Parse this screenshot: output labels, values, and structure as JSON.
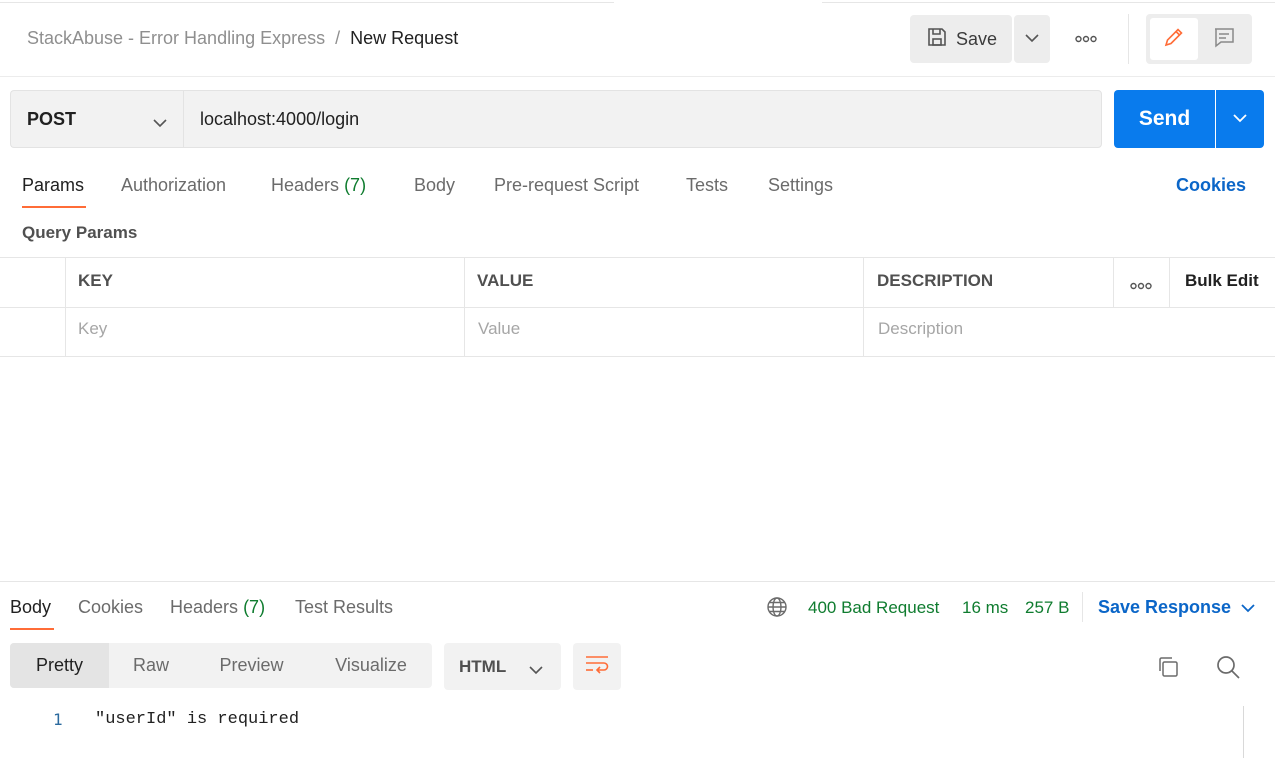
{
  "header": {
    "collection": "StackAbuse - Error Handling Express",
    "separator": "/",
    "request_name": "New Request",
    "save_label": "Save"
  },
  "request": {
    "method": "POST",
    "url": "localhost:4000/login",
    "send_label": "Send"
  },
  "request_tabs": [
    {
      "label": "Params",
      "count": ""
    },
    {
      "label": "Authorization",
      "count": ""
    },
    {
      "label": "Headers",
      "count": "(7)"
    },
    {
      "label": "Body",
      "count": ""
    },
    {
      "label": "Pre-request Script",
      "count": ""
    },
    {
      "label": "Tests",
      "count": ""
    },
    {
      "label": "Settings",
      "count": ""
    }
  ],
  "cookies_link": "Cookies",
  "query_params": {
    "title": "Query Params",
    "columns": [
      "KEY",
      "VALUE",
      "DESCRIPTION"
    ],
    "bulk_edit": "Bulk Edit",
    "placeholders": [
      "Key",
      "Value",
      "Description"
    ]
  },
  "response": {
    "tabs": [
      {
        "label": "Body",
        "count": ""
      },
      {
        "label": "Cookies",
        "count": ""
      },
      {
        "label": "Headers",
        "count": "(7)"
      },
      {
        "label": "Test Results",
        "count": ""
      }
    ],
    "status": "400 Bad Request",
    "time": "16 ms",
    "size": "257 B",
    "save_response": "Save Response",
    "views": [
      "Pretty",
      "Raw",
      "Preview",
      "Visualize"
    ],
    "format": "HTML",
    "lines": [
      {
        "num": "1",
        "text": "\"userId\" is required"
      }
    ]
  },
  "colors": {
    "accent": "#ff6c37",
    "primary": "#097bed",
    "success": "#0f7c2f",
    "link": "#0b66c8"
  },
  "icons": [
    "save-icon",
    "chevron-down-icon",
    "more-icon",
    "edit-icon",
    "comment-icon",
    "globe-icon",
    "wrap-lines-icon",
    "copy-icon",
    "search-icon"
  ]
}
